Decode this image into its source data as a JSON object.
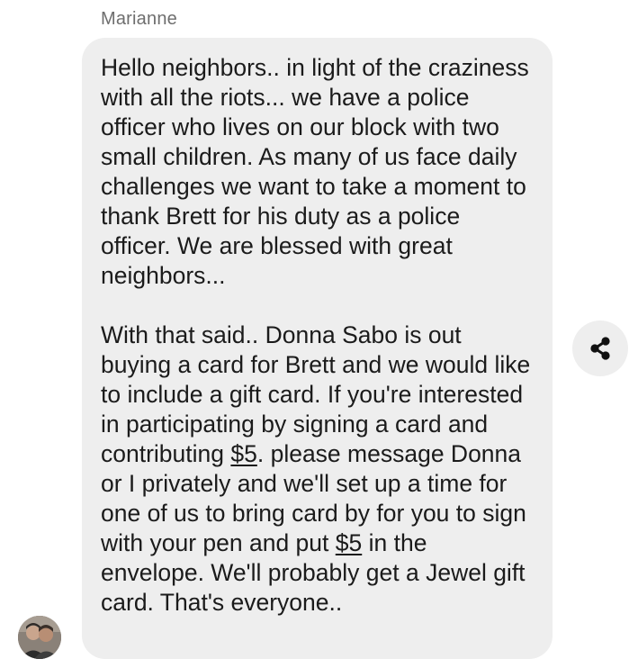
{
  "sender": {
    "name": "Marianne"
  },
  "message": {
    "paragraph1": "Hello neighbors.. in light of the craziness with all the riots... we have a police officer who lives on our block with two small children. As many of us face daily challenges we want to take a moment to thank Brett for his duty as a police officer. We are blessed with great neighbors...",
    "paragraph2_part1": "With that said.. Donna Sabo is out buying a card for Brett and we would like to include a gift card. If you're interested in participating by signing a card and contributing ",
    "amount1": "$5",
    "paragraph2_part2": ". please message Donna or I privately and we'll set up a time for one of us to bring card by for you to sign with your pen and put ",
    "amount2": "$5",
    "paragraph2_part3": " in the envelope. We'll probably get a Jewel gift card. That's everyone.."
  },
  "icons": {
    "share": "share-icon",
    "avatar": "sender-avatar"
  },
  "colors": {
    "bubble_background": "#eeeeee",
    "text": "#1b1b1b",
    "sender_name": "#6e6e6e"
  }
}
